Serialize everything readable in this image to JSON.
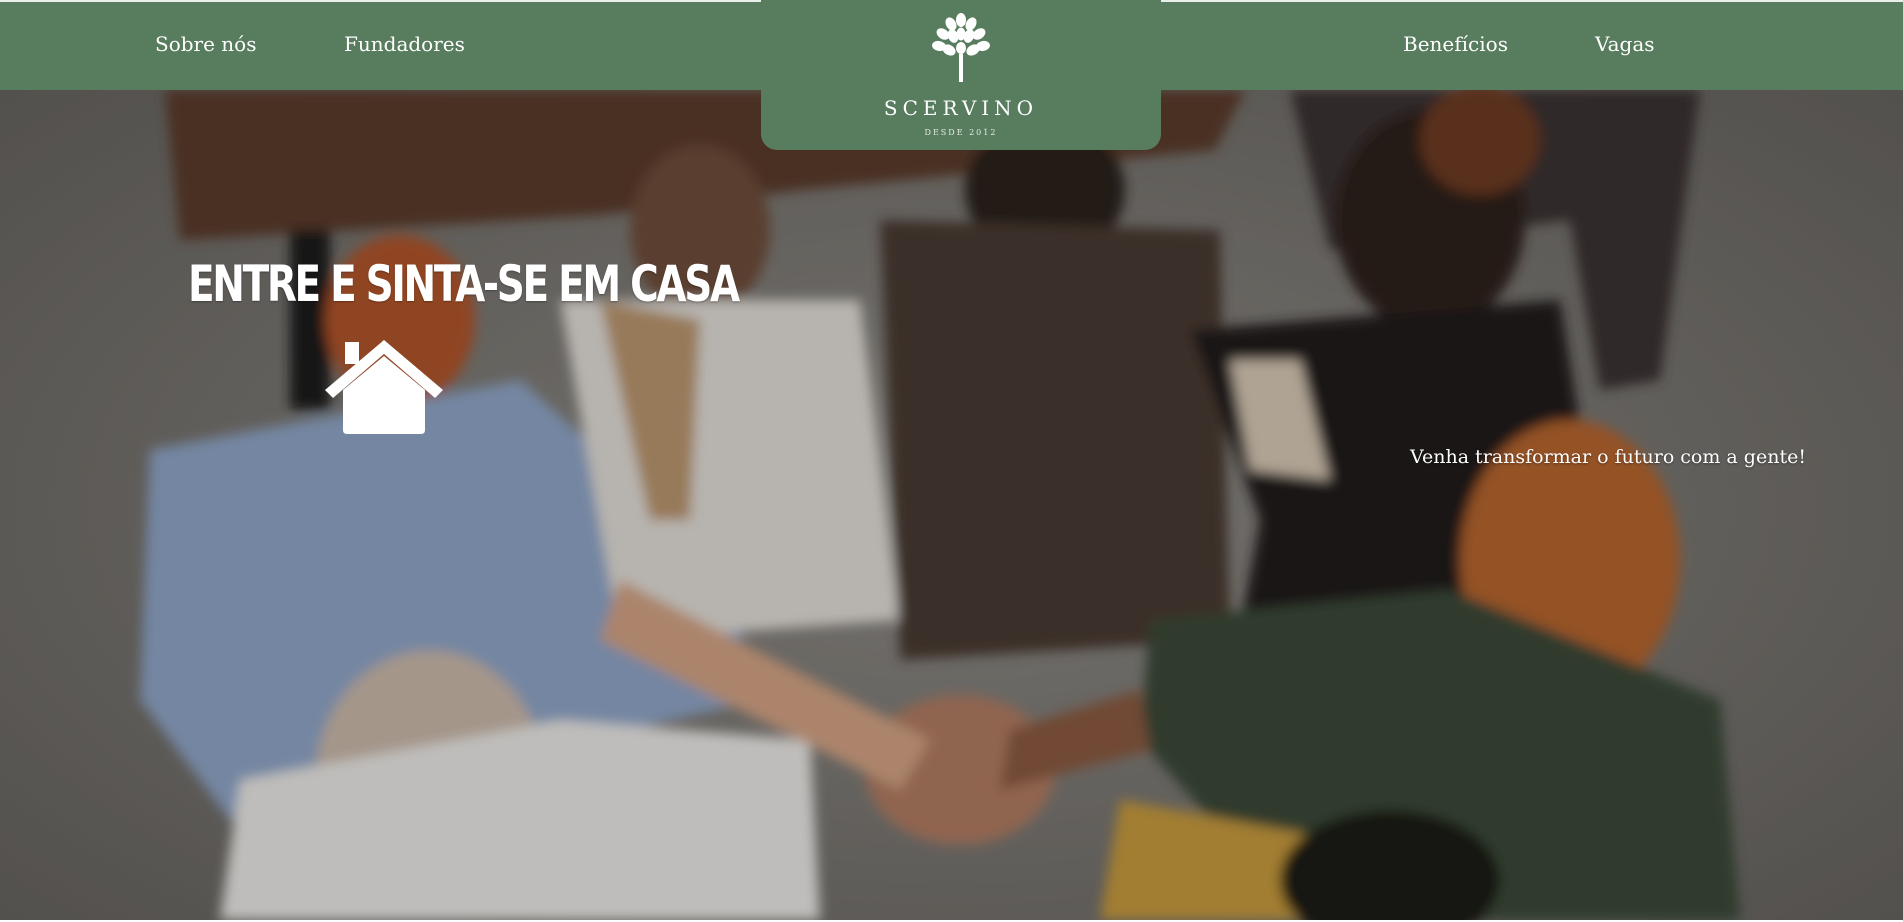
{
  "nav": {
    "left_links": [
      "Sobre nós",
      "Fundadores"
    ],
    "right_links": [
      "Benefícios",
      "Vagas"
    ]
  },
  "logo": {
    "name": "SCERVINO",
    "since": "DESDE 2012",
    "icon": "tree-icon"
  },
  "hero": {
    "headline": "ENTRE E SINTA-SE EM CASA",
    "icon": "home-icon",
    "tagline": "Venha transformar o futuro com a gente!",
    "image": "team-hands-together-photo"
  },
  "colors": {
    "brand_green": "#587c5e",
    "text_light": "#ffffff"
  }
}
